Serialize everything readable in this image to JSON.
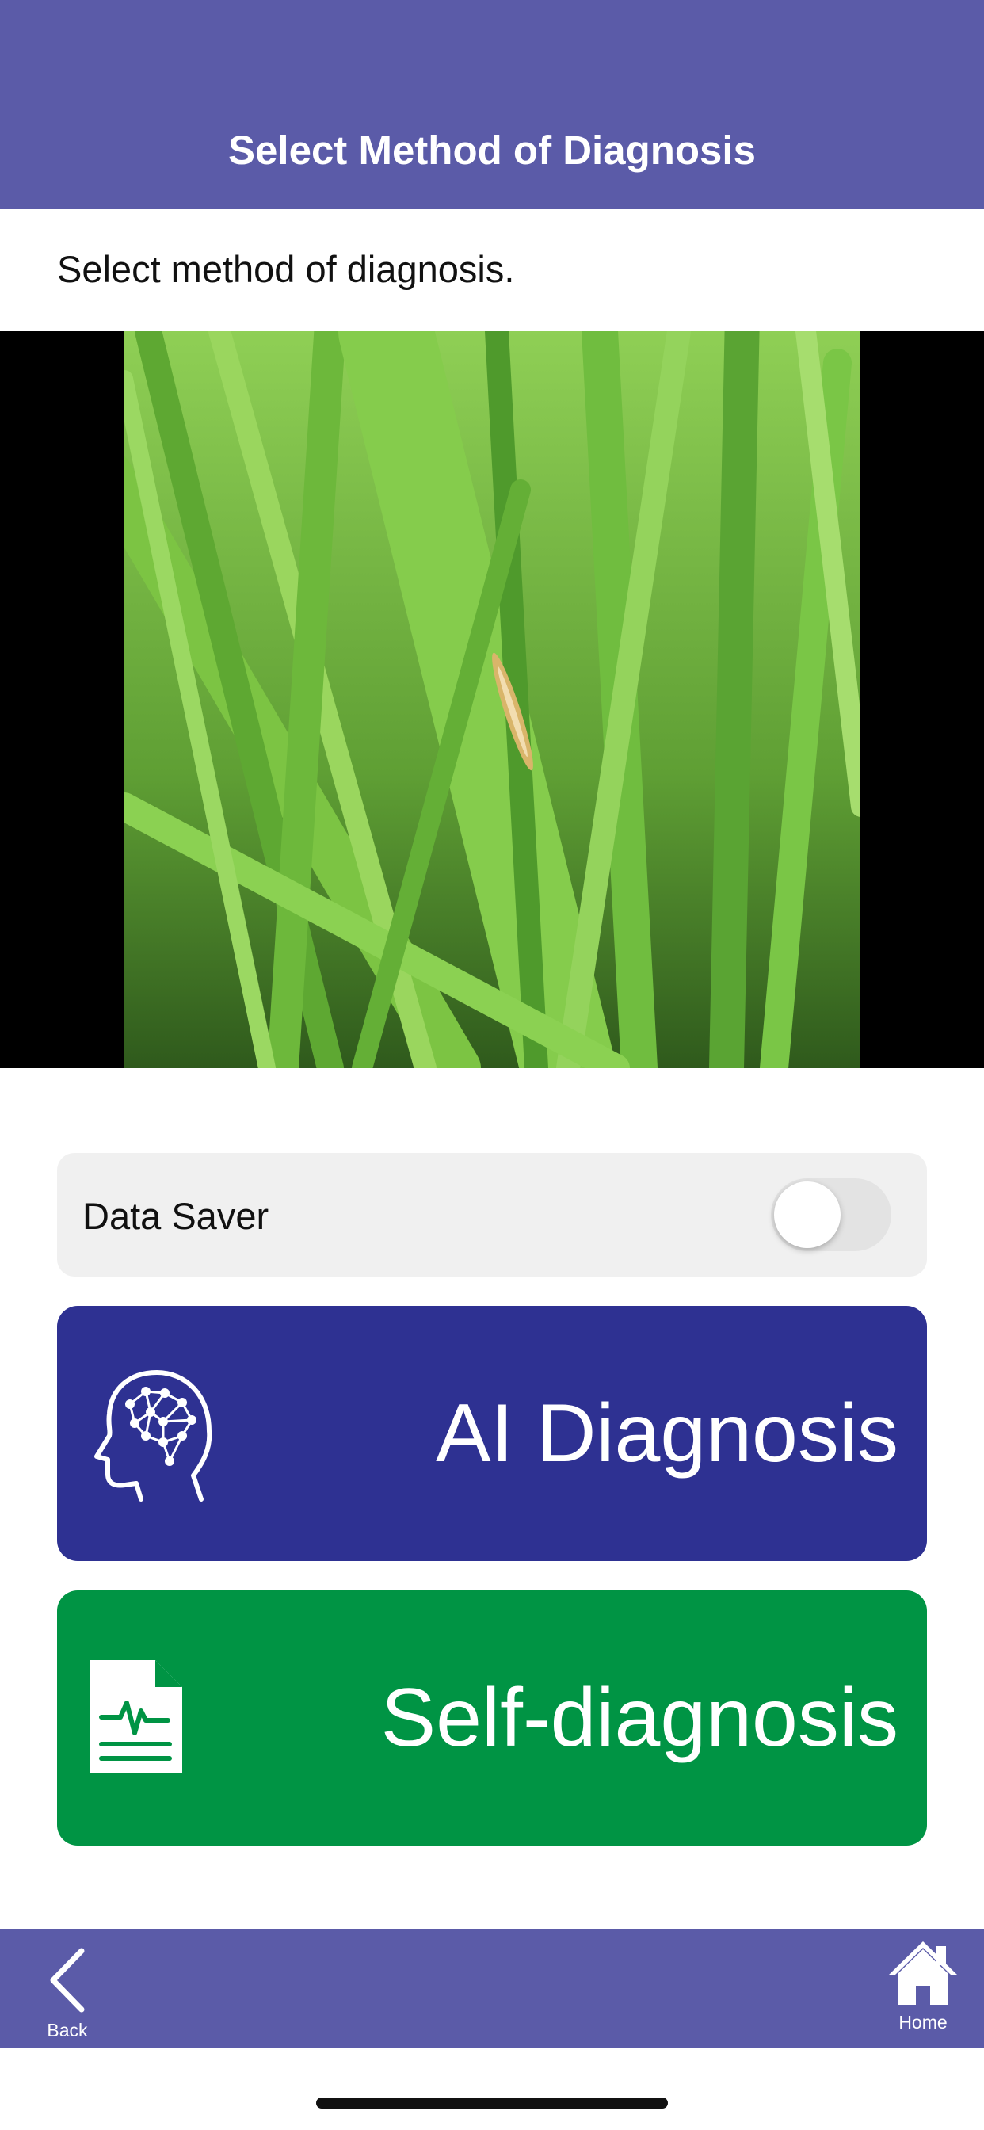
{
  "header": {
    "title": "Select Method of Diagnosis"
  },
  "main": {
    "instruction": "Select method of diagnosis.",
    "data_saver": {
      "label": "Data Saver",
      "enabled": false
    },
    "ai_button": {
      "label": "AI Diagnosis",
      "icon": "brain-head-icon"
    },
    "self_button": {
      "label": "Self-diagnosis",
      "icon": "medical-report-icon"
    }
  },
  "tabbar": {
    "back_label": "Back",
    "home_label": "Home"
  },
  "colors": {
    "nav": "#5b5ba8",
    "ai_button": "#2e3192",
    "self_button": "#009444"
  }
}
